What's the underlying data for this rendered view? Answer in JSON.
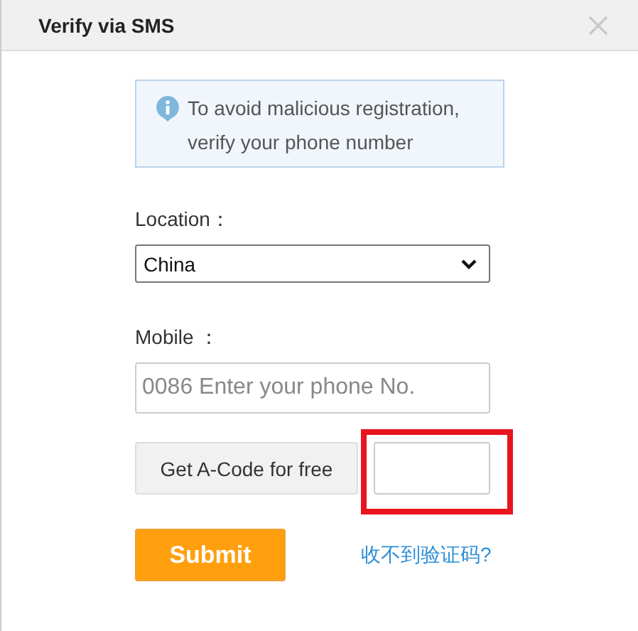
{
  "dialog": {
    "title": "Verify via SMS"
  },
  "notice": {
    "text": "To avoid malicious registration, verify your phone number"
  },
  "location": {
    "label": "Location：",
    "value": "China"
  },
  "mobile": {
    "label": "Mobile ：",
    "placeholder": "0086 Enter your phone No."
  },
  "code": {
    "button": "Get A-Code for free",
    "highlighted": true
  },
  "submit": "Submit",
  "help_link": "收不到验证码?"
}
